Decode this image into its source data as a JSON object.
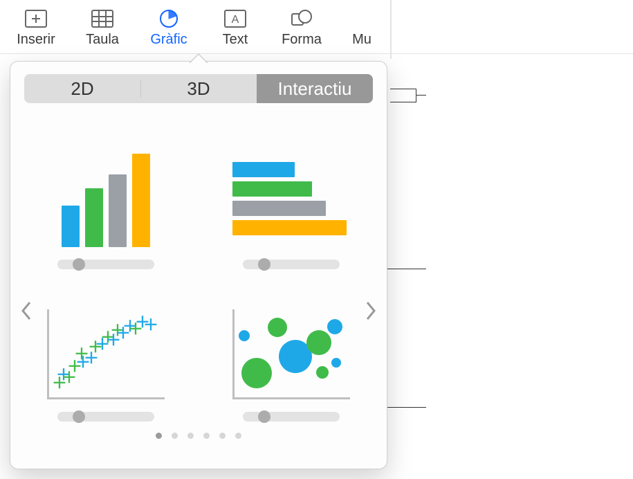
{
  "toolbar": {
    "insert_label": "Inserir",
    "table_label": "Taula",
    "chart_label": "Gràfic",
    "text_label": "Text",
    "shape_label": "Forma",
    "media_label_cut": "Mu"
  },
  "popover": {
    "tabs": {
      "t0": "2D",
      "t1": "3D",
      "t2": "Interactiu"
    },
    "page_count": 6,
    "page_current": 1
  }
}
